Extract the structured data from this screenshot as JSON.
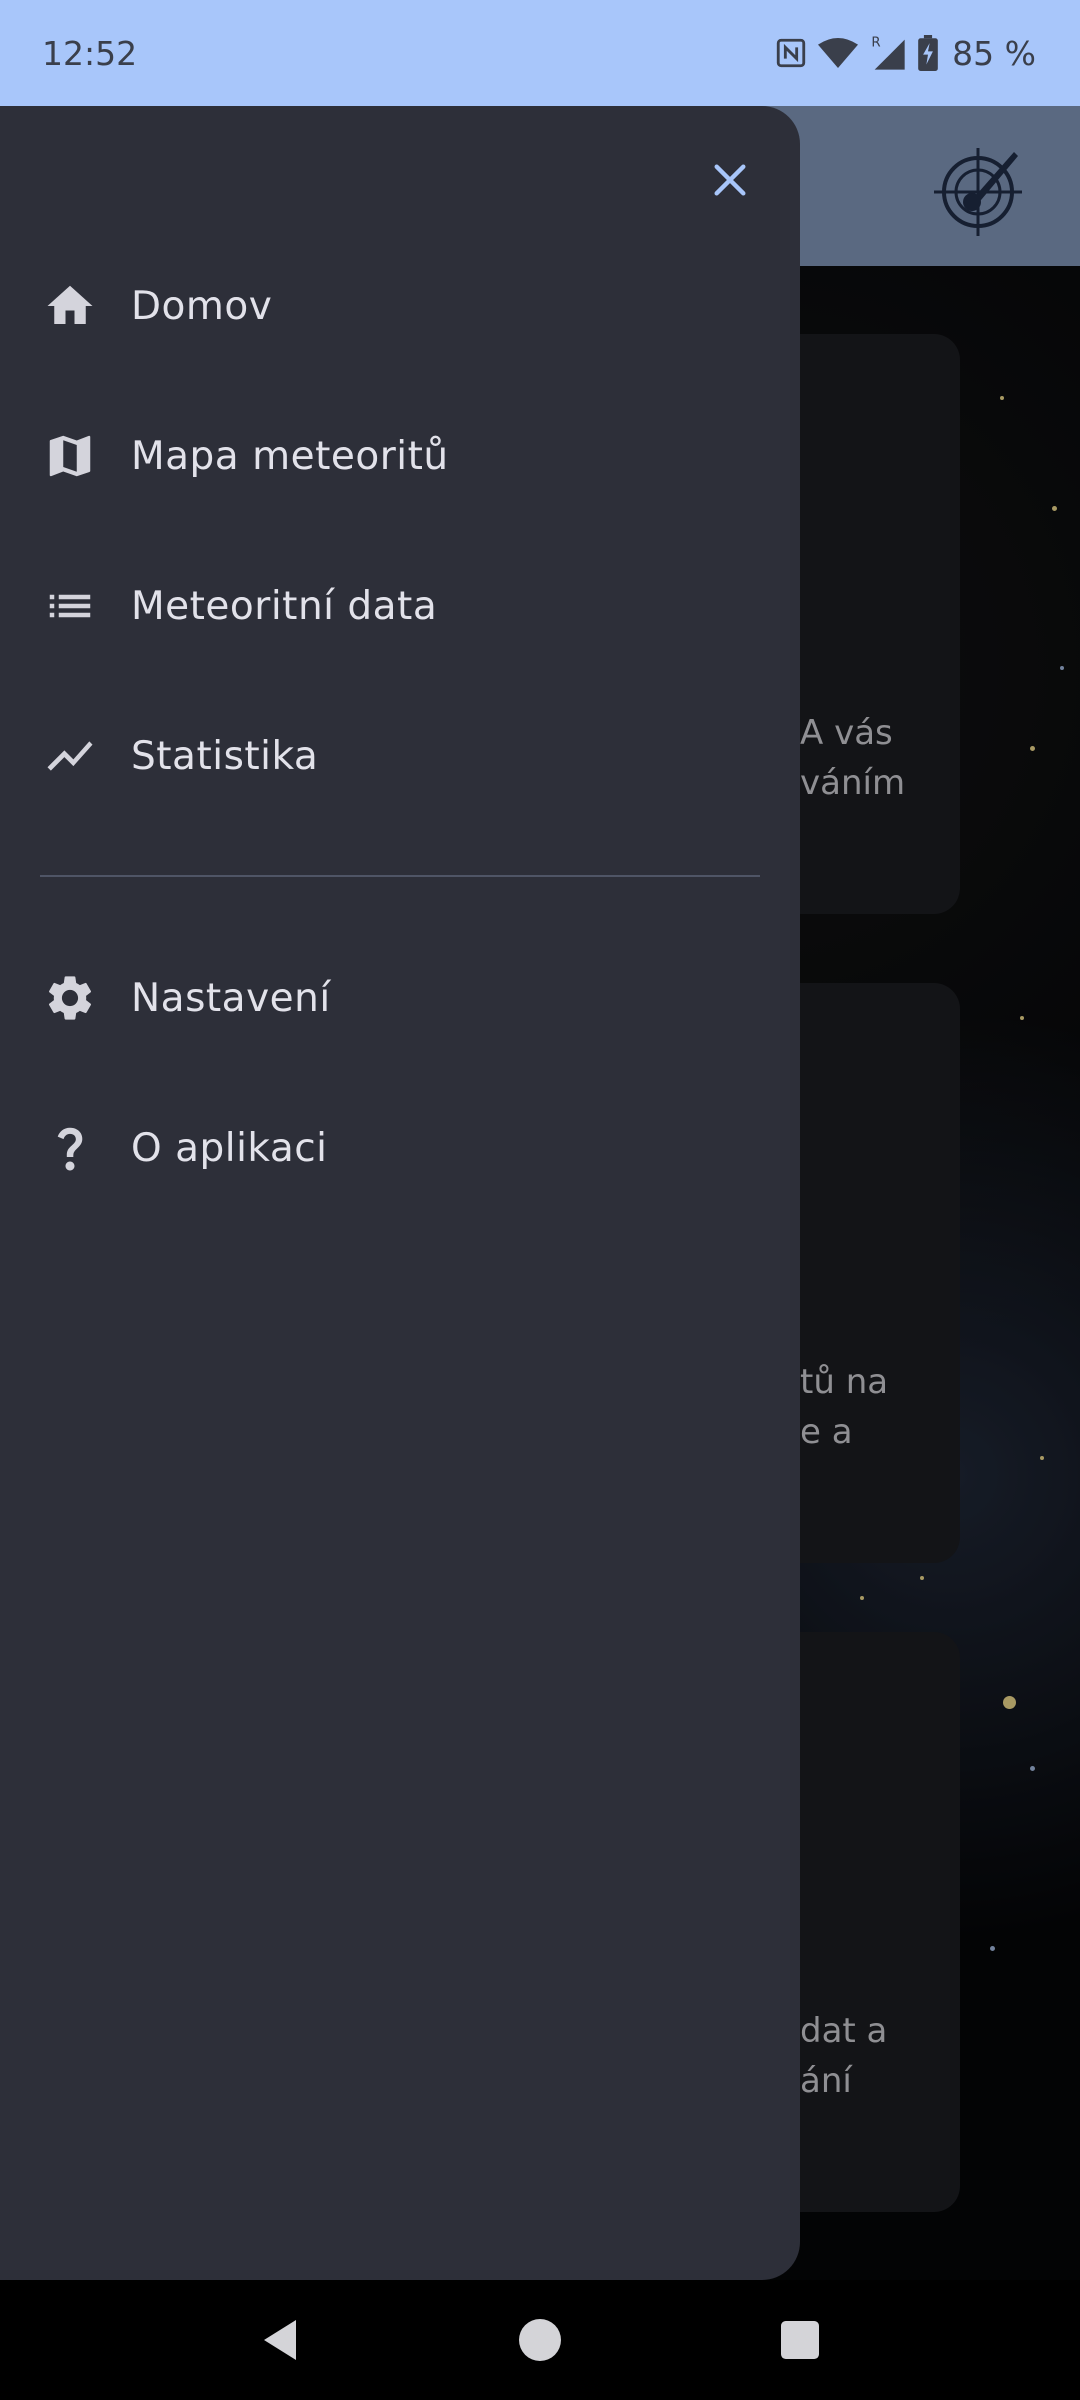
{
  "status_bar": {
    "time": "12:52",
    "battery": "85 %"
  },
  "background_cards": [
    {
      "text_line1": "A vás",
      "text_line2": "váním"
    },
    {
      "text_line1": "tů na",
      "text_line2": "e a"
    },
    {
      "text_line1": "dat a",
      "text_line2": "ání"
    }
  ],
  "drawer": {
    "items": [
      {
        "label": "Domov",
        "icon": "home-icon"
      },
      {
        "label": "Mapa meteoritů",
        "icon": "map-icon"
      },
      {
        "label": "Meteoritní data",
        "icon": "list-icon"
      },
      {
        "label": "Statistika",
        "icon": "trending-icon"
      }
    ],
    "secondary_items": [
      {
        "label": "Nastavení",
        "icon": "gear-icon"
      },
      {
        "label": "O aplikaci",
        "icon": "help-icon"
      }
    ]
  },
  "colors": {
    "status_bar": "#a8c6fa",
    "drawer_bg": "#2d2f39",
    "accent": "#a8c6fa",
    "app_bar": "#7d92b3"
  }
}
